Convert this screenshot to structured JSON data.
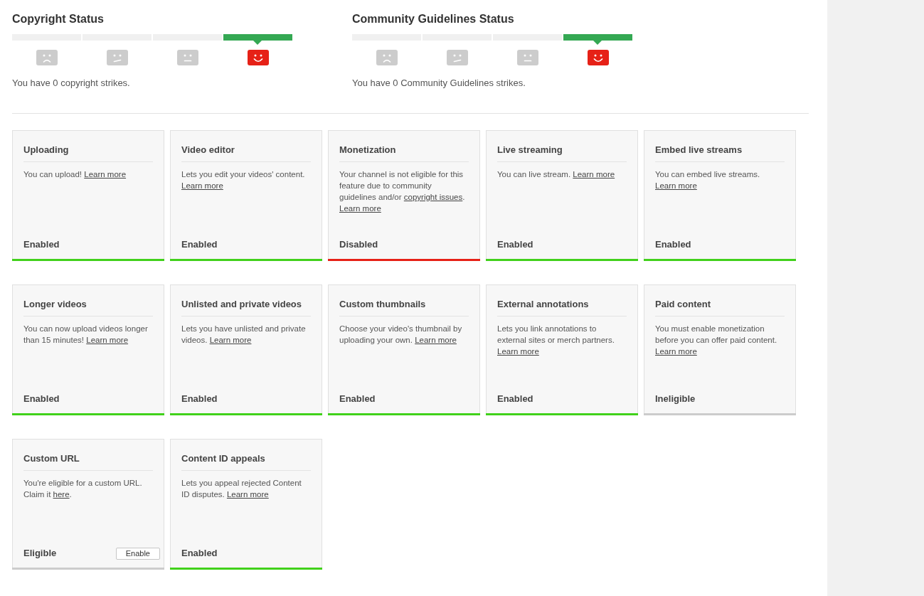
{
  "strike_statuses": [
    {
      "title": "Copyright Status",
      "segments": [
        {
          "kind": "sad",
          "selected": false
        },
        {
          "kind": "uneasy",
          "selected": false
        },
        {
          "kind": "neutral",
          "selected": false
        },
        {
          "kind": "happy",
          "selected": true
        }
      ],
      "summary": "You have 0 copyright strikes."
    },
    {
      "title": "Community Guidelines Status",
      "segments": [
        {
          "kind": "sad",
          "selected": false
        },
        {
          "kind": "uneasy",
          "selected": false
        },
        {
          "kind": "neutral",
          "selected": false
        },
        {
          "kind": "happy",
          "selected": true
        }
      ],
      "summary": "You have 0 Community Guidelines strikes."
    }
  ],
  "features": [
    {
      "title": "Uploading",
      "description": [
        {
          "kind": "text",
          "text": "You can upload! "
        },
        {
          "kind": "link",
          "text": "Learn more"
        }
      ],
      "status": "Enabled",
      "color": "#41d11b"
    },
    {
      "title": "Video editor",
      "description": [
        {
          "kind": "text",
          "text": "Lets you edit your videos' content. "
        },
        {
          "kind": "link",
          "text": "Learn more"
        }
      ],
      "status": "Enabled",
      "color": "#41d11b"
    },
    {
      "title": "Monetization",
      "description": [
        {
          "kind": "text",
          "text": "Your channel is not eligible for this feature due to community guidelines and/or "
        },
        {
          "kind": "link",
          "text": "copyright issues"
        },
        {
          "kind": "text",
          "text": ". "
        },
        {
          "kind": "link",
          "text": "Learn more"
        }
      ],
      "status": "Disabled",
      "color": "#e62117"
    },
    {
      "title": "Live streaming",
      "description": [
        {
          "kind": "text",
          "text": "You can live stream. "
        },
        {
          "kind": "link",
          "text": "Learn more"
        }
      ],
      "status": "Enabled",
      "color": "#41d11b"
    },
    {
      "title": "Embed live streams",
      "description": [
        {
          "kind": "text",
          "text": "You can embed live streams. "
        },
        {
          "kind": "link",
          "text": "Learn more"
        }
      ],
      "status": "Enabled",
      "color": "#41d11b"
    },
    {
      "title": "Longer videos",
      "description": [
        {
          "kind": "text",
          "text": "You can now upload videos longer than 15 minutes! "
        },
        {
          "kind": "link",
          "text": "Learn more"
        }
      ],
      "status": "Enabled",
      "color": "#41d11b"
    },
    {
      "title": "Unlisted and private videos",
      "description": [
        {
          "kind": "text",
          "text": "Lets you have unlisted and private videos. "
        },
        {
          "kind": "link",
          "text": "Learn more"
        }
      ],
      "status": "Enabled",
      "color": "#41d11b"
    },
    {
      "title": "Custom thumbnails",
      "description": [
        {
          "kind": "text",
          "text": "Choose your video's thumbnail by uploading your own. "
        },
        {
          "kind": "link",
          "text": "Learn more"
        }
      ],
      "status": "Enabled",
      "color": "#41d11b"
    },
    {
      "title": "External annotations",
      "description": [
        {
          "kind": "text",
          "text": "Lets you link annotations to external sites or merch partners. "
        },
        {
          "kind": "link",
          "text": "Learn more"
        }
      ],
      "status": "Enabled",
      "color": "#41d11b"
    },
    {
      "title": "Paid content",
      "description": [
        {
          "kind": "text",
          "text": "You must enable monetization before you can offer paid content. "
        },
        {
          "kind": "link",
          "text": "Learn more"
        }
      ],
      "status": "Ineligible",
      "color": "#cccccc"
    },
    {
      "title": "Custom URL",
      "description": [
        {
          "kind": "text",
          "text": "You're eligible for a custom URL. Claim it "
        },
        {
          "kind": "link",
          "text": "here"
        },
        {
          "kind": "text",
          "text": "."
        }
      ],
      "status": "Eligible",
      "button": "Enable",
      "color": "#cccccc"
    },
    {
      "title": "Content ID appeals",
      "description": [
        {
          "kind": "text",
          "text": "Lets you appeal rejected Content ID disputes. "
        },
        {
          "kind": "link",
          "text": "Learn more"
        }
      ],
      "status": "Enabled",
      "color": "#41d11b"
    }
  ]
}
